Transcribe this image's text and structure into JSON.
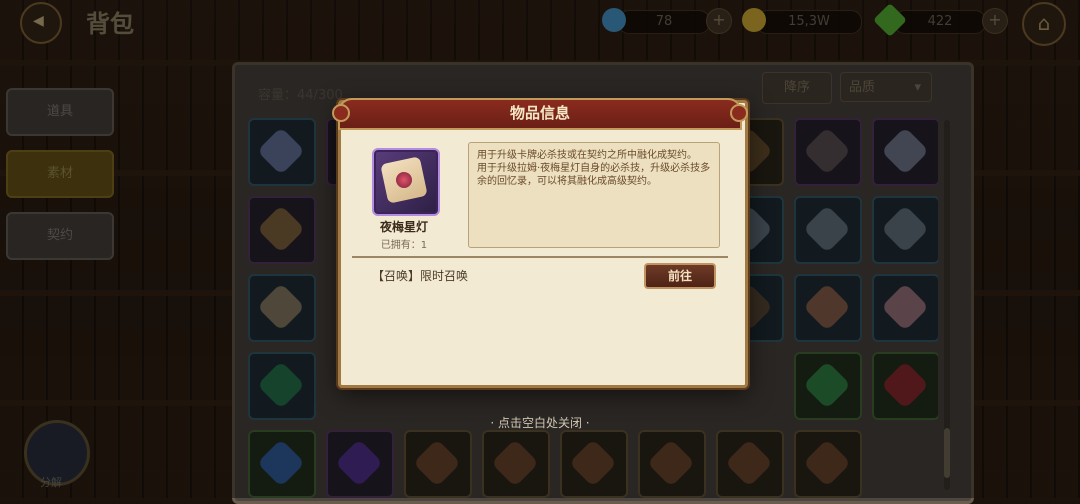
{
  "header": {
    "title": "背包"
  },
  "resources": [
    {
      "name": "blue-gem",
      "value": "78",
      "color": "#4aa0d8"
    },
    {
      "name": "gold-coin",
      "value": "15,3W",
      "color": "#e0b838"
    },
    {
      "name": "green-leaf",
      "value": "422",
      "color": "#5cc03a"
    }
  ],
  "tabs": [
    {
      "label": "道具",
      "active": false
    },
    {
      "label": "素材",
      "active": true
    },
    {
      "label": "契约",
      "active": false
    }
  ],
  "map_label": "分解",
  "inventory": {
    "count_label": "容量：",
    "count_value": "44/300",
    "sort_label": "降序",
    "filter_label": "品质"
  },
  "dialog": {
    "title": "物品信息",
    "item_name": "夜梅星灯",
    "owned": "已拥有：1",
    "description_1": "用于升级卡牌必杀技或在契约之所中融化成契约。",
    "description_2": "用于升级拉姆·夜梅星灯自身的必杀技，升级必杀技多余的回忆录，可以将其融化成高级契约。",
    "source": "【召唤】限时召唤",
    "go_button": "前往"
  },
  "close_hint": "· 点击空白处关闭 ·",
  "colors": {
    "header_red": "#7a2419",
    "parchment": "#f3ead4",
    "gold_border": "#c29a5a"
  }
}
